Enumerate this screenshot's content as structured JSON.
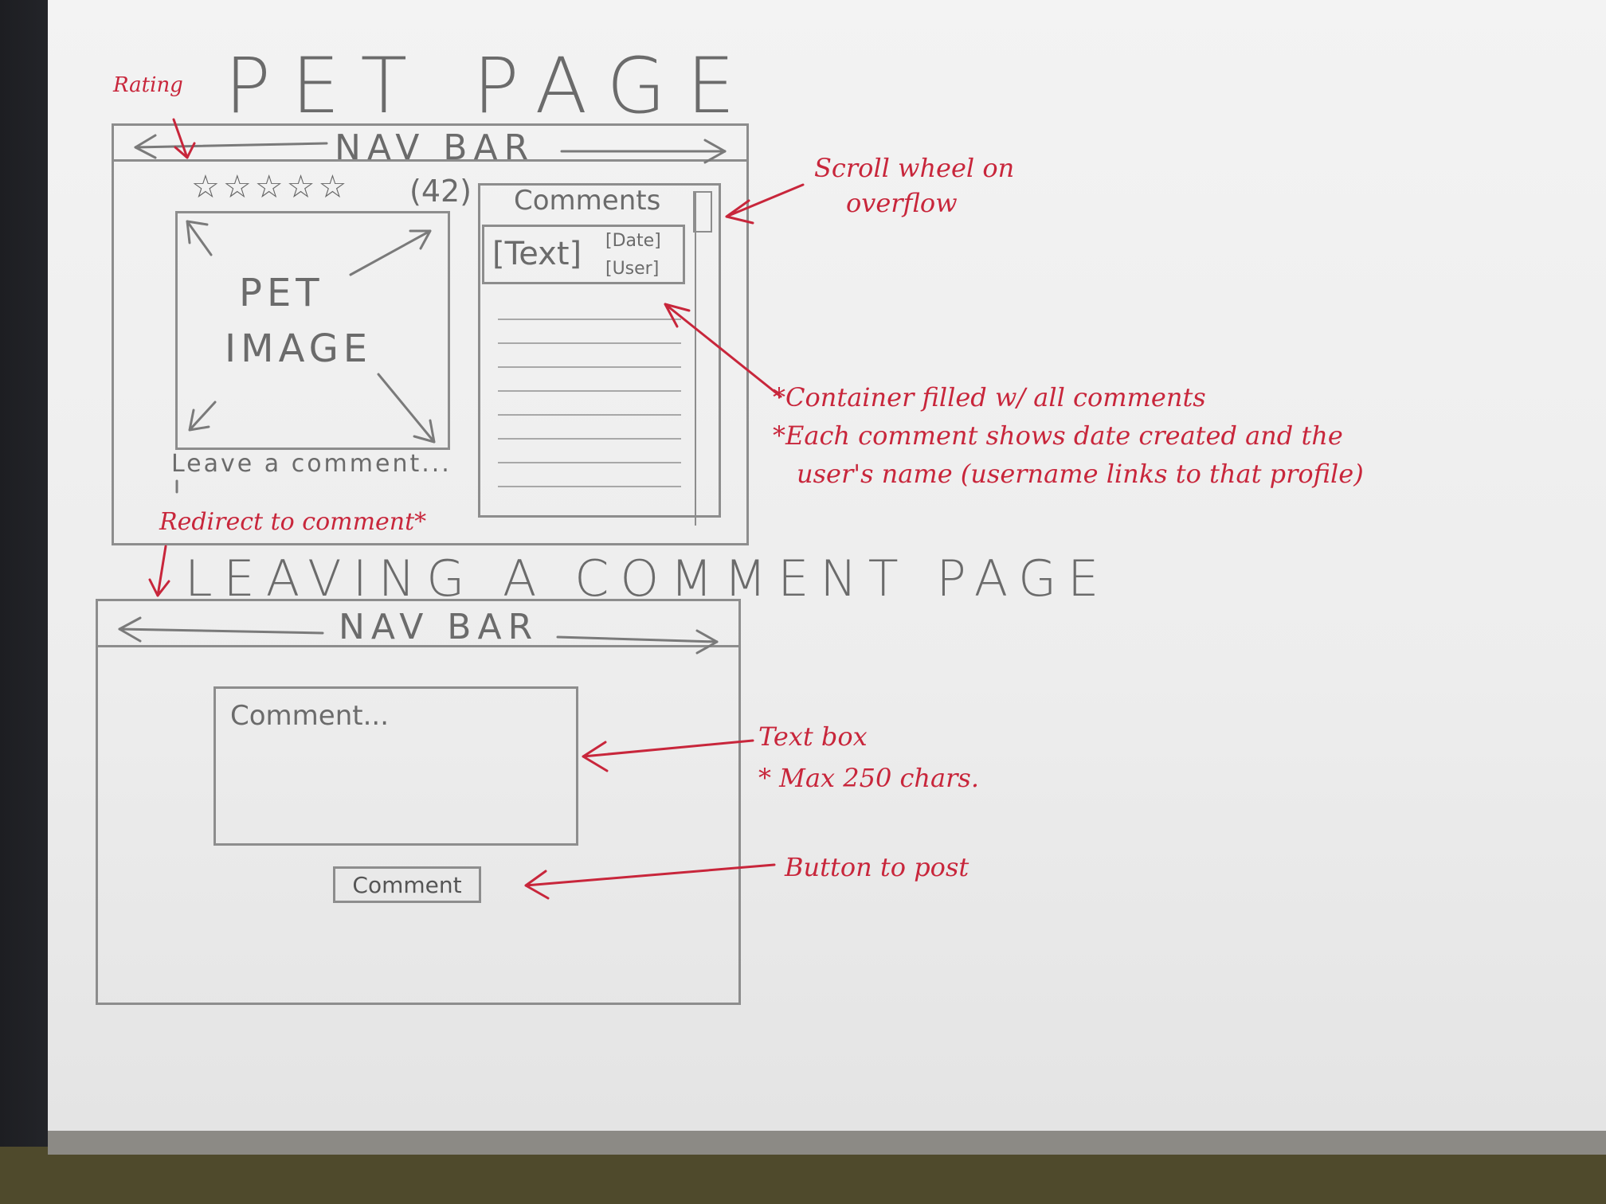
{
  "pet_page": {
    "title": "PET PAGE",
    "nav_bar": "NAV BAR",
    "rating_count": "(42)",
    "rating_stars": 5,
    "image_label_line1": "PET",
    "image_label_line2": "IMAGE",
    "comments_title": "Comments",
    "comment_text": "[Text]",
    "comment_date": "[Date]",
    "comment_user": "[User]",
    "leave_comment_link": "Leave a comment..."
  },
  "comment_page": {
    "title": "LEAVING A COMMENT PAGE",
    "nav_bar": "NAV BAR",
    "textbox_placeholder": "Comment...",
    "button_label": "Comment"
  },
  "annotations": {
    "rating": "Rating",
    "scroll_line1": "Scroll wheel on",
    "scroll_line2": "overflow",
    "container_line1": "*Container filled w/ all comments",
    "container_line2": "*Each comment shows date created and the",
    "container_line3": "user's name (username links to that profile)",
    "redirect": "Redirect to comment*",
    "textbox_line1": "Text box",
    "textbox_line2": "* Max 250 chars.",
    "button_note": "Button to post"
  },
  "colors": {
    "pencil": "#6b6b6b",
    "red_ink": "#c8263b",
    "paper": "#f0f0f0"
  }
}
